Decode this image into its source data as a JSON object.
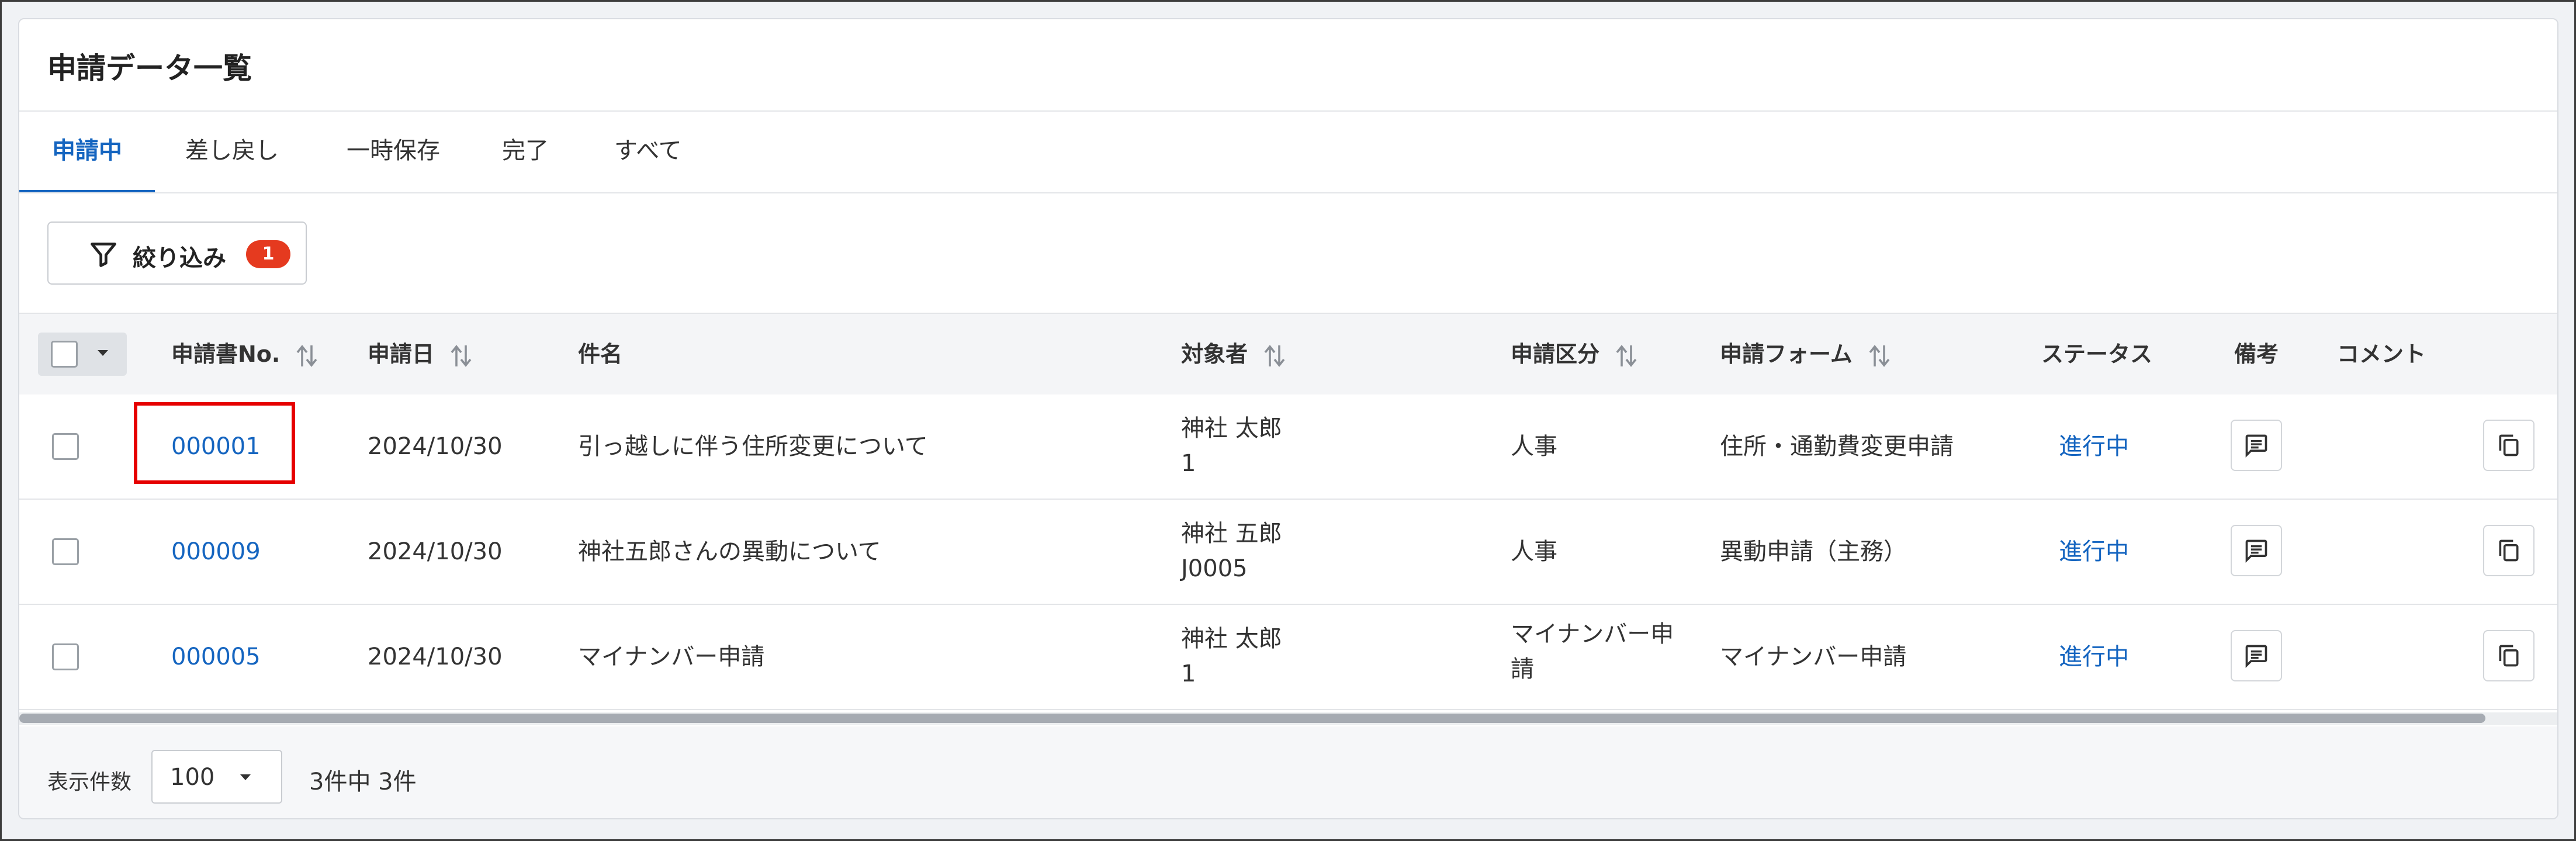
{
  "page": {
    "title": "申請データ一覧"
  },
  "tabs": [
    {
      "label": "申請中",
      "active": true
    },
    {
      "label": "差し戻し"
    },
    {
      "label": "一時保存"
    },
    {
      "label": "完了"
    },
    {
      "label": "すべて"
    }
  ],
  "filter": {
    "label": "絞り込み",
    "count": "1",
    "icon": "filter-icon"
  },
  "table": {
    "columns": [
      "申請書No.",
      "申請日",
      "件名",
      "対象者",
      "申請区分",
      "申請フォーム",
      "ステータス",
      "備考",
      "コメント"
    ],
    "rows": [
      {
        "no": "000001",
        "date": "2024/10/30",
        "subject": "引っ越しに伴う住所変更について",
        "target_name": "神社 太郎",
        "target_id": "1",
        "category": "人事",
        "form": "住所・通勤費変更申請",
        "status": "進行中"
      },
      {
        "no": "000009",
        "date": "2024/10/30",
        "subject": "神社五郎さんの異動について",
        "target_name": "神社 五郎",
        "target_id": "J0005",
        "category": "人事",
        "form": "異動申請（主務）",
        "status": "進行中"
      },
      {
        "no": "000005",
        "date": "2024/10/30",
        "subject": "マイナンバー申請",
        "target_name": "神社 太郎",
        "target_id": "1",
        "category_line1": "マイナンバー申",
        "category_line2": "請",
        "form": "マイナンバー申請",
        "status": "進行中"
      }
    ]
  },
  "footer": {
    "per_page_label": "表示件数",
    "per_page_value": "100",
    "count_text": "3件中 3件"
  },
  "colors": {
    "accent": "#1565c0",
    "badge": "#e53a1f",
    "highlight": "#e60000"
  }
}
